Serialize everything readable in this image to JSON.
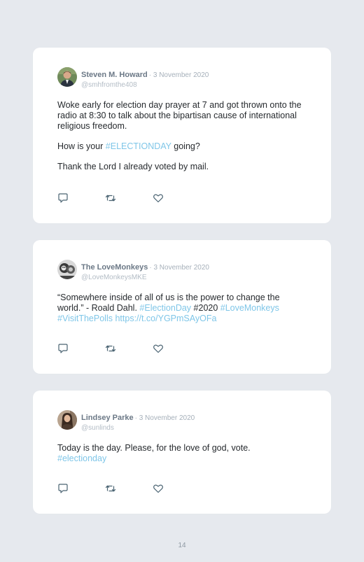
{
  "tweets": [
    {
      "name": "Steven M. Howard",
      "date": "· 3 November 2020",
      "handle": "@smhfromthe408",
      "para1": "Woke early for election day prayer at 7 and got thrown onto the radio at 8:30 to talk about the bipartisan cause of international religious freedom.",
      "para2_pre": "How is your ",
      "para2_tag": "#ELECTIONDAY",
      "para2_post": " going?",
      "para3": "Thank the Lord I already voted by mail."
    },
    {
      "name": "The LoveMonkeys",
      "date": "· 3 November 2020",
      "handle": "@LoveMonkeysMKE",
      "text_pre": "“Somewhere inside of all of us is the power to change the world.” - Roald Dahl. ",
      "tag1": "#ElectionDay",
      "text_mid": " #2020 ",
      "tag2": "#LoveMonkeys",
      "tag3": "#VisitThePolls",
      "link": "https://t.co/YGPmSAyOFa"
    },
    {
      "name": "Lindsey Parke",
      "date": "· 3 November 2020",
      "handle": "@sunlinds",
      "text": "Today is the day. Please, for the love of god, vote.",
      "tag": "#electionday"
    }
  ],
  "icons": {
    "reply": "reply-icon",
    "retweet": "retweet-icon",
    "like": "heart-icon"
  },
  "colors": {
    "background": "#e6e9ee",
    "card": "#ffffff",
    "hashtag": "#7fc6e8",
    "name": "#6b7886",
    "icon": "#4a6372"
  },
  "page_number": "14"
}
